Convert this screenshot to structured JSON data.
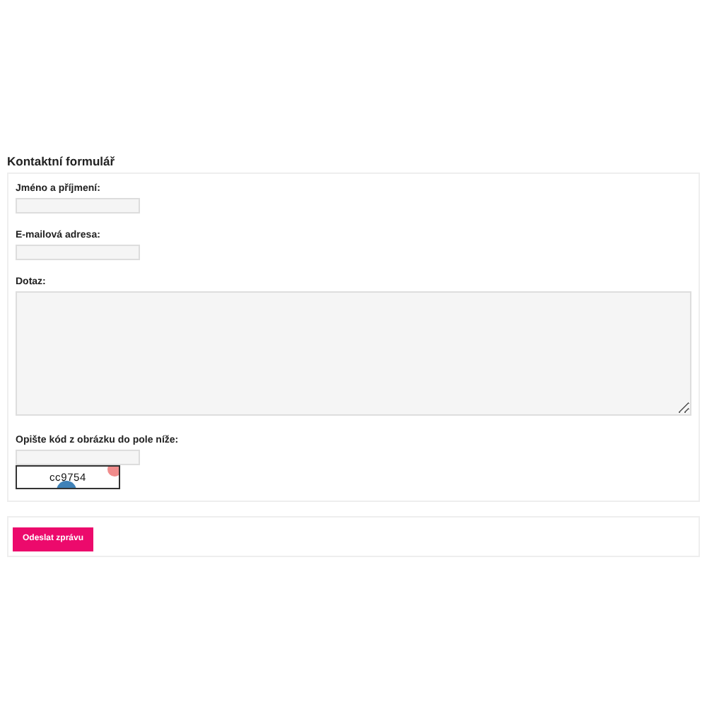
{
  "form": {
    "title": "Kontaktní formulář",
    "fields": [
      {
        "kind": "input",
        "label": "Jméno a příjmení:"
      },
      {
        "kind": "input",
        "label": "E-mailová adresa:"
      },
      {
        "kind": "textarea",
        "label": "Dotaz:"
      },
      {
        "kind": "captcha",
        "label": "Opište kód z obrázku do pole níže:",
        "code": "cc9754"
      }
    ],
    "submit": "Odeslat zprávu"
  }
}
